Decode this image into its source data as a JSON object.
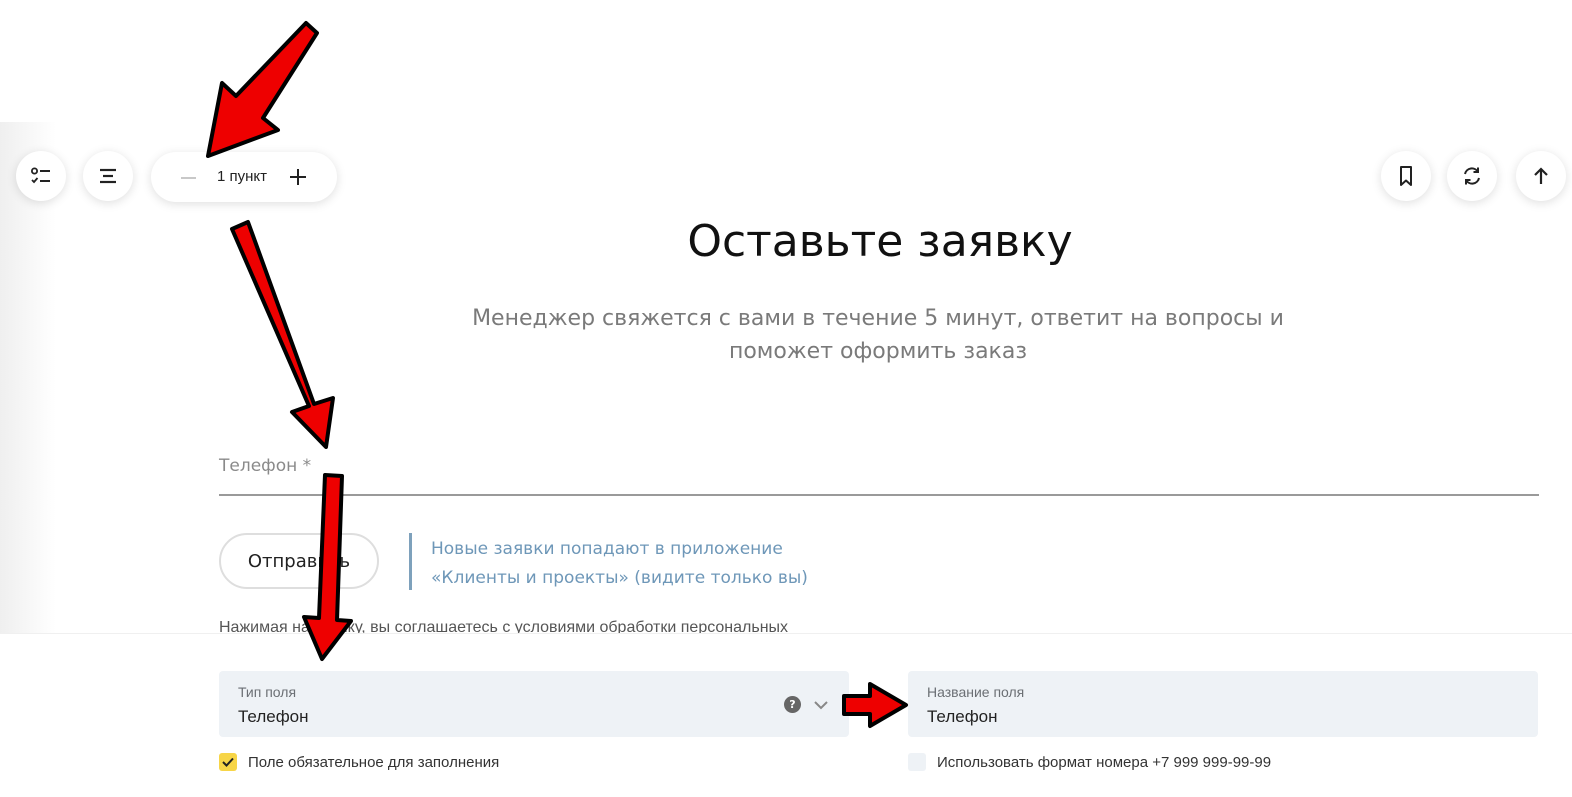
{
  "toolbar": {
    "checklist_button_icon": "checklist-icon",
    "align_button_icon": "align-center-icon",
    "stepper": {
      "minus_icon": "minus-icon",
      "count_label": "1 пункт",
      "plus_icon": "plus-icon"
    },
    "bookmark_button_icon": "bookmark-icon",
    "refresh_button_icon": "refresh-icon",
    "up_button_icon": "arrow-up-icon"
  },
  "form": {
    "title": "Оставьте заявку",
    "subtitle_line1": "Менеджер свяжется с вами в течение 5 минут, ответит на вопросы и",
    "subtitle_line2": "поможет оформить заказ",
    "phone_label": "Телефон *",
    "submit_label": "Отправить",
    "info_line1": "Новые заявки попадают в приложение",
    "info_line2": "«Клиенты и проекты» (видите только вы)",
    "consent_text": "Нажимая на кнопку, вы соглашаетесь с условиями обработки персональных"
  },
  "field_settings": {
    "type_label": "Тип поля",
    "type_value": "Телефон",
    "help_symbol": "?",
    "name_label": "Название поля",
    "name_value": "Телефон",
    "required": {
      "checked": true,
      "label": "Поле обязательное для заполнения"
    },
    "phone_format": {
      "checked": false,
      "label": "Использовать формат номера +7 999 999-99-99"
    }
  },
  "colors": {
    "arrow": "#ee0000",
    "accent_checkbox": "#f7d547",
    "info_text": "#6e97b8",
    "field_background": "#eef2f6"
  }
}
